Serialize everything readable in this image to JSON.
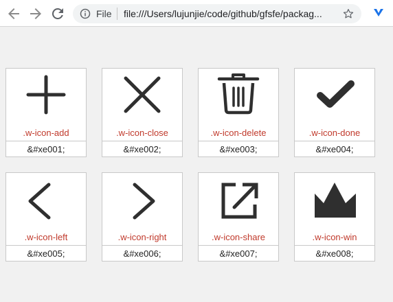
{
  "browser": {
    "scheme": "File",
    "url": "file:///Users/lujunjie/code/github/gfsfe/packag...",
    "icons": {
      "back": "back-arrow-icon",
      "forward": "forward-arrow-icon",
      "reload": "reload-icon",
      "info": "info-icon",
      "star": "star-icon",
      "extension": "extension-icon"
    }
  },
  "icons": [
    {
      "name": "add",
      "class_name": ".w-icon-add",
      "code": "&#xe001;"
    },
    {
      "name": "close",
      "class_name": ".w-icon-close",
      "code": "&#xe002;"
    },
    {
      "name": "delete",
      "class_name": ".w-icon-delete",
      "code": "&#xe003;"
    },
    {
      "name": "done",
      "class_name": ".w-icon-done",
      "code": "&#xe004;"
    },
    {
      "name": "left",
      "class_name": ".w-icon-left",
      "code": "&#xe005;"
    },
    {
      "name": "right",
      "class_name": ".w-icon-right",
      "code": "&#xe006;"
    },
    {
      "name": "share",
      "class_name": ".w-icon-share",
      "code": "&#xe007;"
    },
    {
      "name": "win",
      "class_name": ".w-icon-win",
      "code": "&#xe008;"
    }
  ],
  "colors": {
    "class_label": "#c0392b",
    "glyph": "#2f2f2f"
  }
}
